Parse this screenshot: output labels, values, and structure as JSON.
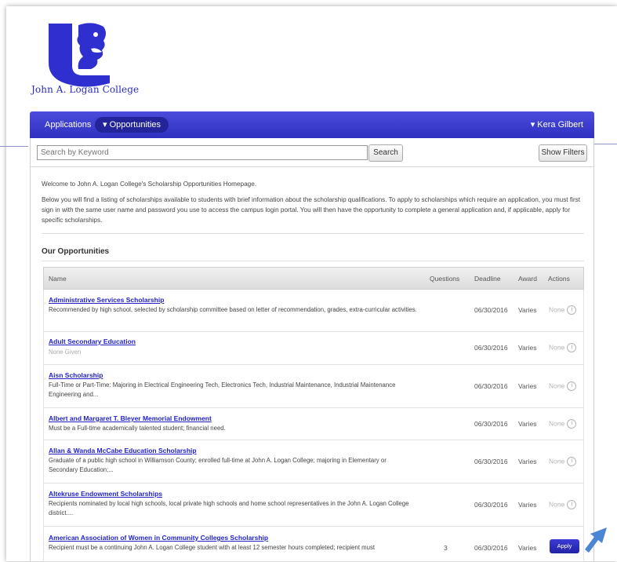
{
  "brand": {
    "college_name": "John A. Logan College",
    "accent": "#3030c4"
  },
  "nav": {
    "applications": "Applications",
    "opportunities": "▾ Opportunities",
    "user": "▾ Kera Gilbert"
  },
  "search": {
    "placeholder": "Search by Keyword",
    "button": "Search",
    "filters": "Show Filters"
  },
  "intro": {
    "welcome": "Welcome to John A. Logan College's Scholarship Opportunities Homepage.",
    "body": "Below you will find a listing of scholarships available to students with brief information about the scholarship qualifications. To apply to scholarships which require an application, you must first sign in with the same user name and password you use to access the campus login portal. You will then have the opportunity to complete a general application and, if applicable, apply for specific scholarships."
  },
  "section_title": "Our Opportunities",
  "table": {
    "headers": {
      "name": "Name",
      "questions": "Questions",
      "deadline": "Deadline",
      "award": "Award",
      "actions": "Actions"
    },
    "rows": [
      {
        "name": "Administrative Services Scholarship",
        "desc": "Recommended by high school, selected by scholarship committee based on letter of recommendation, grades, extra-curricular activities.",
        "questions": "",
        "deadline": "06/30/2016",
        "award": "Varies",
        "action": "None"
      },
      {
        "name": "Adult Secondary Education",
        "desc": "None Given",
        "questions": "",
        "deadline": "06/30/2016",
        "award": "Varies",
        "action": "None"
      },
      {
        "name": "Aisn Scholarship",
        "desc": "Full-Time or Part-Time: Majoring in Electrical Engineering Tech, Electronics Tech, Industrial Maintenance, Industrial Maintenance Engineering and...",
        "questions": "",
        "deadline": "06/30/2016",
        "award": "Varies",
        "action": "None"
      },
      {
        "name": "Albert and Margaret T. Bleyer Memorial Endowment",
        "desc": "Must be a Full-time academically talented student; financial need.",
        "questions": "",
        "deadline": "06/30/2016",
        "award": "Varies",
        "action": "None"
      },
      {
        "name": "Allan & Wanda McCabe Education Scholarship",
        "desc": "Graduate of a public high school in Williamson County; enrolled full-time at John A. Logan College; majoring in Elementary or Secondary Education;...",
        "questions": "",
        "deadline": "06/30/2016",
        "award": "Varies",
        "action": "None"
      },
      {
        "name": "Altekruse Endowment Scholarships",
        "desc": "Recipients nominated by local high schools, local private high schools and home school representatives in the John A. Logan College district....",
        "questions": "",
        "deadline": "06/30/2016",
        "award": "Varies",
        "action": "None"
      },
      {
        "name": "American Association of Women in Community Colleges Scholarship",
        "desc": "Recipient must be a continuing John A. Logan College student with at least 12 semester hours completed; recipient must",
        "questions": "3",
        "deadline": "06/30/2016",
        "award": "Varies",
        "action": "Apply"
      }
    ]
  }
}
